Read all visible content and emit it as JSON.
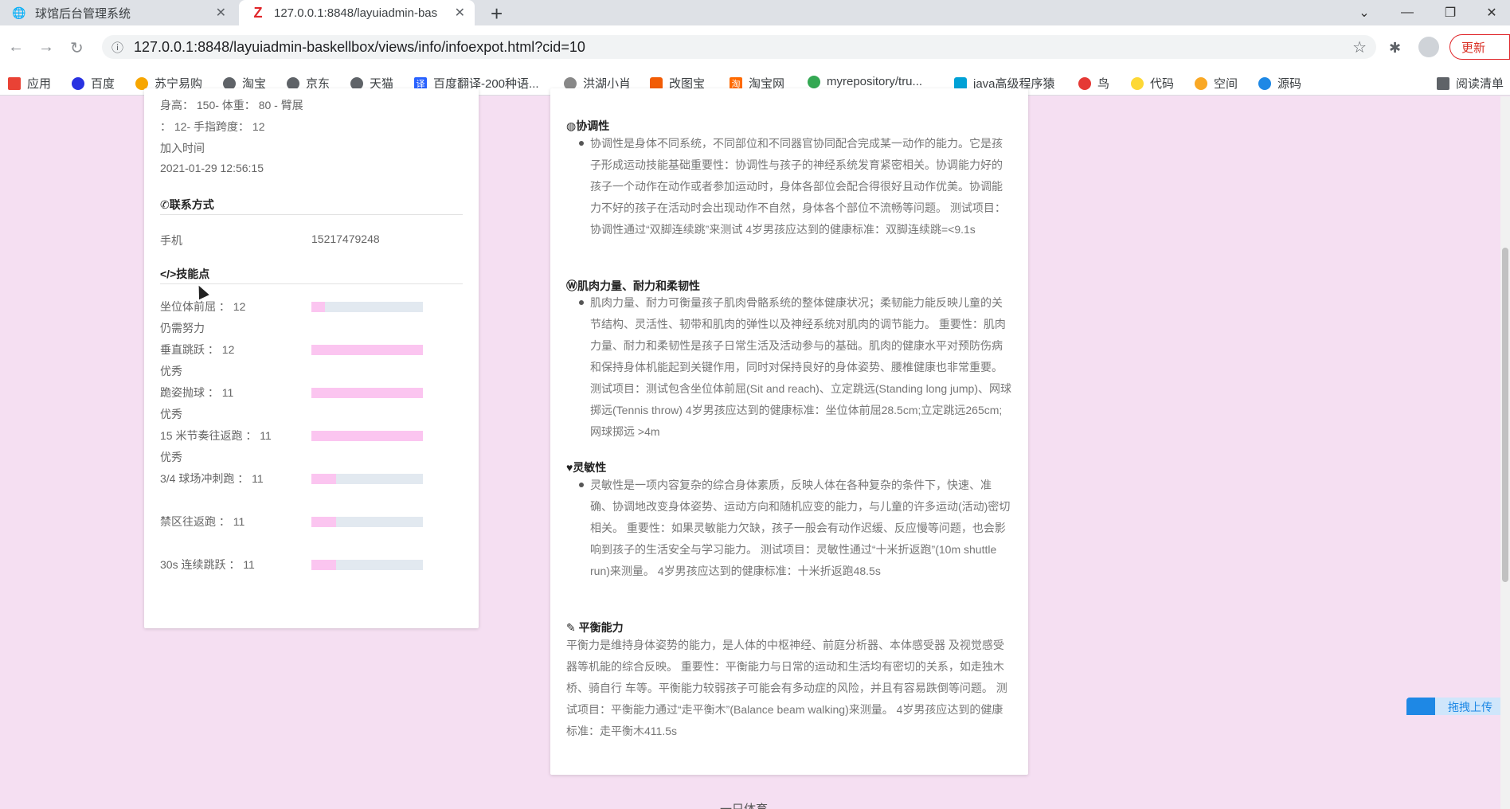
{
  "browser": {
    "tabs": [
      {
        "title": "球馆后台管理系统",
        "close": "✕"
      },
      {
        "title": "127.0.0.1:8848/layuiadmin-bas",
        "close": "✕"
      }
    ],
    "new_tab": "+",
    "url": "127.0.0.1:8848/layuiadmin-baskellbox/views/info/infoexpot.html?cid=10",
    "update_label": "更新",
    "bookmarks": [
      "应用",
      "百度",
      "苏宁易购",
      "淘宝",
      "京东",
      "天猫",
      "百度翻译-200种语...",
      "洪湖小肖",
      "改图宝",
      "淘宝网",
      "myrepository/tru...",
      "java高级程序猿",
      "鸟",
      "代码",
      "空间",
      "源码"
    ],
    "reading_list": "阅读清单"
  },
  "profile": {
    "body_line1": "身高： 150- 体重： 80 - 臂展",
    "body_line2": "： 12- 手指跨度： 12",
    "join_label": "加入时间",
    "join_time": "2021-01-29 12:56:15",
    "contact_title": "联系方式",
    "phone_label": "手机",
    "phone_value": "15217479248",
    "skills_title": "技能点",
    "skills": [
      {
        "label": "坐位体前屈 ： 12",
        "status": "仍需努力",
        "level": 0.12
      },
      {
        "label": "垂直跳跃 ： 12",
        "status": "优秀",
        "level": 1.0
      },
      {
        "label": "跪姿抛球 ： 11",
        "status": "优秀",
        "level": 1.0
      },
      {
        "label": "15 米节奏往返跑 ： 11",
        "status": "优秀",
        "level": 1.0
      },
      {
        "label": "3/4 球场冲刺跑 ： 11",
        "status": "",
        "level": 0.22
      },
      {
        "label": "禁区往返跑 ： 11",
        "status": "",
        "level": 0.22
      },
      {
        "label": "30s 连续跳跃 ： 11",
        "status": "",
        "level": 0.22
      }
    ]
  },
  "sections": {
    "coordination": {
      "title": "协调性",
      "body": "协调性是身体不同系统，不同部位和不同器官协同配合完成某一动作的能力。它是孩子形成运动技能基础重要性：协调性与孩子的神经系统发育紧密相关。协调能力好的孩子一个动作在动作或者参加运动时，身体各部位会配合得很好且动作优美。协调能力不好的孩子在活动时会出现动作不自然，身体各个部位不流畅等问题。 测试项目：协调性通过“双脚连续跳”来测试 4岁男孩应达到的健康标准：双脚连续跳=<9.1s"
    },
    "muscle": {
      "title": "肌肉力量、耐力和柔韧性",
      "body": "肌肉力量、耐力可衡量孩子肌肉骨骼系统的整体健康状况；柔韧能力能反映儿童的关节结构、灵活性、韧带和肌肉的弹性以及神经系统对肌肉的调节能力。 重要性：肌肉力量、耐力和柔韧性是孩子日常生活及活动参与的基础。肌肉的健康水平对预防伤病和保持身体机能起到关键作用，同时对保持良好的身体姿势、腰椎健康也非常重要。 测试项目：测试包含坐位体前屈(Sit and reach)、立定跳远(Standing long jump)、网球掷远(Tennis throw) 4岁男孩应达到的健康标准：坐位体前屈28.5cm;立定跳远265cm;网球掷远 >4m"
    },
    "agility": {
      "title": "灵敏性",
      "body": "灵敏性是一项内容复杂的综合身体素质，反映人体在各种复杂的条件下，快速、准确、协调地改变身体姿势、运动方向和随机应变的能力，与儿童的许多运动(活动)密切相关。 重要性：如果灵敏能力欠缺，孩子一般会有动作迟缓、反应慢等问题，也会影 响到孩子的生活安全与学习能力。 测试项目：灵敏性通过“十米折返跑”(10m shuttle run)来测量。 4岁男孩应达到的健康标准：十米折返跑48.5s"
    },
    "balance": {
      "title": "平衡能力",
      "body": "平衡力是维持身体姿势的能力，是人体的中枢神经、前庭分析器、本体感受器 及视觉感受器等机能的综合反映。 重要性：平衡能力与日常的运动和生活均有密切的关系，如走独木桥、骑自行 车等。平衡能力较弱孩子可能会有多动症的风险，并且有容易跌倒等问题。 测试项目：平衡能力通过“走平衡木”(Balance beam walking)来测量。 4岁男孩应达到的健康标准：走平衡木411.5s"
    }
  },
  "footer": "一只体育",
  "upload_widget": "拖拽上传"
}
